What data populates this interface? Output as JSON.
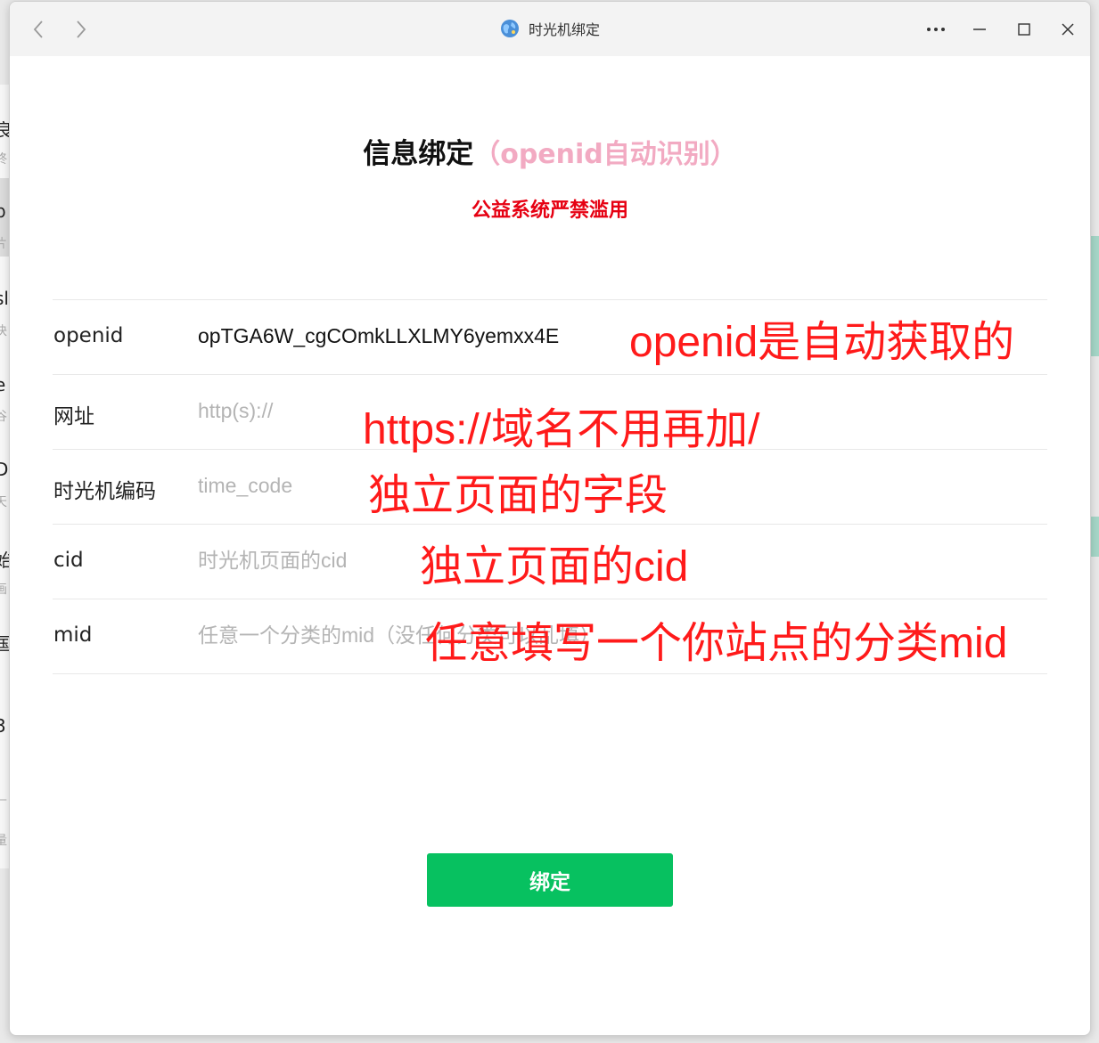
{
  "window": {
    "title": "时光机绑定"
  },
  "page": {
    "heading": "信息绑定",
    "heading_hint": "（openid自动识别）",
    "warning": "公益系统严禁滥用"
  },
  "form": {
    "rows": [
      {
        "label": "openid",
        "value": "opTGA6W_cgCOmkLLXLMY6yemxx4E"
      },
      {
        "label": "网址",
        "placeholder": "http(s)://"
      },
      {
        "label": "时光机编码",
        "placeholder": "time_code"
      },
      {
        "label": "cid",
        "placeholder": "时光机页面的cid"
      },
      {
        "label": "mid",
        "placeholder": "任意一个分类的mid（没任何分类可以乱填）"
      }
    ],
    "submit_label": "绑定"
  },
  "annotations": [
    "openid是自动获取的",
    "https://域名不用再加/",
    "独立页面的字段",
    "独立页面的cid",
    "任意填写一个你站点的分类mid"
  ],
  "background_window": {
    "left_fragments": [
      "良",
      "终",
      "b",
      "片",
      "sl",
      "块",
      "e",
      "谷",
      "D",
      "天",
      "始",
      "画",
      "国",
      "3",
      "—",
      "量"
    ]
  },
  "colors": {
    "primary_green": "#07c160",
    "warning_red": "#e60012",
    "hint_pink": "#f2aac2",
    "annotation_red": "#ff1a1a",
    "placeholder_gray": "#b4b4b4"
  },
  "icons": {
    "back": "chevron-left-icon",
    "forward": "chevron-right-icon",
    "site": "globe-icon",
    "more": "more-icon",
    "minimize": "minimize-icon",
    "maximize": "maximize-icon",
    "close": "close-icon"
  }
}
